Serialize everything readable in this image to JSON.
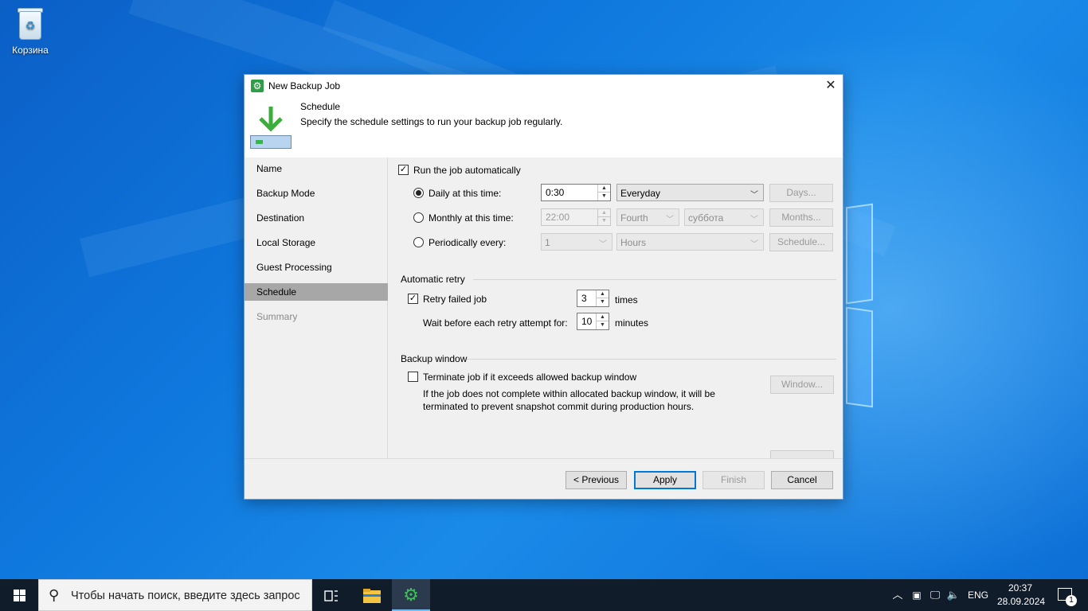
{
  "desktop": {
    "recycle_bin_label": "Корзина"
  },
  "dialog": {
    "title": "New Backup Job",
    "close_glyph": "✕",
    "header_title": "Schedule",
    "header_desc": "Specify the schedule settings to run your backup job regularly."
  },
  "nav": {
    "items": [
      {
        "label": "Name",
        "state": "normal"
      },
      {
        "label": "Backup Mode",
        "state": "normal"
      },
      {
        "label": "Destination",
        "state": "normal"
      },
      {
        "label": "Local Storage",
        "state": "normal"
      },
      {
        "label": "Guest Processing",
        "state": "normal"
      },
      {
        "label": "Schedule",
        "state": "active"
      },
      {
        "label": "Summary",
        "state": "disabled"
      }
    ]
  },
  "schedule": {
    "run_auto_label": "Run the job automatically",
    "run_auto_checked": true,
    "daily_label": "Daily at this time:",
    "daily_selected": true,
    "daily_time": "0:30",
    "daily_freq": "Everyday",
    "days_button": "Days...",
    "monthly_label": "Monthly at this time:",
    "monthly_time": "22:00",
    "monthly_week": "Fourth",
    "monthly_day": "суббота",
    "months_button": "Months...",
    "periodic_label": "Periodically every:",
    "periodic_value": "1",
    "periodic_unit": "Hours",
    "schedule_button": "Schedule..."
  },
  "retry": {
    "group_title": "Automatic retry",
    "retry_label": "Retry failed job",
    "retry_checked": true,
    "retry_count": "3",
    "times_label": "times",
    "wait_label": "Wait before each retry attempt for:",
    "wait_value": "10",
    "minutes_label": "minutes"
  },
  "window": {
    "group_title": "Backup window",
    "terminate_label": "Terminate job if it exceeds allowed backup window",
    "terminate_checked": false,
    "window_button": "Window...",
    "desc_line1": "If the job does not complete within allocated backup window, it will be",
    "desc_line2": "terminated to prevent snapshot commit during production hours."
  },
  "footer": {
    "previous": "< Previous",
    "apply": "Apply",
    "finish": "Finish",
    "cancel": "Cancel"
  },
  "taskbar": {
    "search_placeholder": "Чтобы начать поиск, введите здесь запрос",
    "language": "ENG",
    "time": "20:37",
    "date": "28.09.2024",
    "notification_count": "1"
  },
  "colors": {
    "accent": "#0078d7",
    "app_green": "#2e9d46",
    "taskbar_bg": "#101c2a",
    "nav_active": "#a7a7a7"
  }
}
